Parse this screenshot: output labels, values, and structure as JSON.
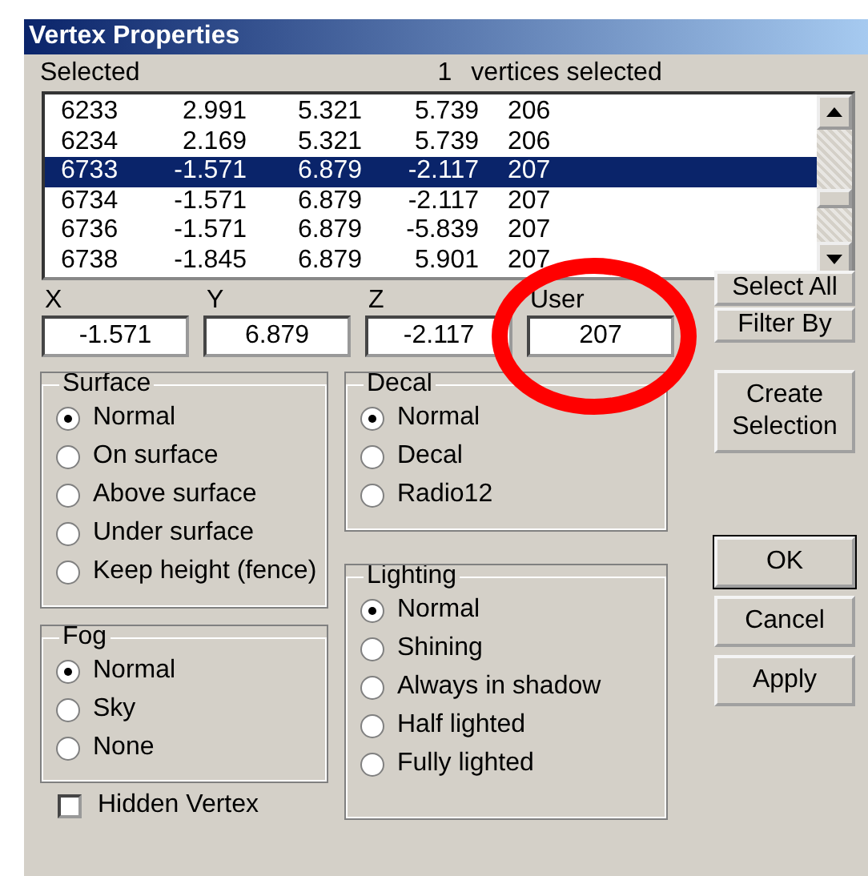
{
  "window": {
    "title": "Vertex Properties"
  },
  "selection": {
    "label": "Selected",
    "count": "1",
    "count_label": "vertices selected"
  },
  "vertex_list": {
    "rows": [
      {
        "cells": [
          "6233",
          "2.991",
          "5.321",
          "5.739",
          "206"
        ],
        "selected": false
      },
      {
        "cells": [
          "6234",
          "2.169",
          "5.321",
          "5.739",
          "206"
        ],
        "selected": false
      },
      {
        "cells": [
          "6733",
          "-1.571",
          "6.879",
          "-2.117",
          "207"
        ],
        "selected": true
      },
      {
        "cells": [
          "6734",
          "-1.571",
          "6.879",
          "-2.117",
          "207"
        ],
        "selected": false
      },
      {
        "cells": [
          "6736",
          "-1.571",
          "6.879",
          "-5.839",
          "207"
        ],
        "selected": false
      },
      {
        "cells": [
          "6738",
          "-1.845",
          "6.879",
          "5.901",
          "207"
        ],
        "selected": false
      }
    ]
  },
  "fields": [
    {
      "label": "X",
      "value": "-1.571"
    },
    {
      "label": "Y",
      "value": "6.879"
    },
    {
      "label": "Z",
      "value": "-2.117"
    },
    {
      "label": "User",
      "value": "207"
    }
  ],
  "surface": {
    "title": "Surface",
    "options": [
      {
        "label": "Normal",
        "selected": true
      },
      {
        "label": "On surface",
        "selected": false
      },
      {
        "label": "Above surface",
        "selected": false
      },
      {
        "label": "Under surface",
        "selected": false
      },
      {
        "label": "Keep height (fence)",
        "selected": false
      }
    ]
  },
  "fog": {
    "title": "Fog",
    "options": [
      {
        "label": "Normal",
        "selected": true
      },
      {
        "label": "Sky",
        "selected": false
      },
      {
        "label": "None",
        "selected": false
      }
    ]
  },
  "hidden_vertex": {
    "label": "Hidden Vertex",
    "checked": false
  },
  "decal": {
    "title": "Decal",
    "options": [
      {
        "label": "Normal",
        "selected": true
      },
      {
        "label": "Decal",
        "selected": false
      },
      {
        "label": "Radio12",
        "selected": false
      }
    ]
  },
  "lighting": {
    "title": "Lighting",
    "options": [
      {
        "label": "Normal",
        "selected": true
      },
      {
        "label": "Shining",
        "selected": false
      },
      {
        "label": "Always in shadow",
        "selected": false
      },
      {
        "label": "Half lighted",
        "selected": false
      },
      {
        "label": "Fully lighted",
        "selected": false
      }
    ]
  },
  "top_buttons": [
    {
      "label": "Select All"
    },
    {
      "label": "Filter By"
    }
  ],
  "create_button": {
    "label": "Create Selection"
  },
  "dialog_buttons": [
    {
      "label": "OK",
      "default": true
    },
    {
      "label": "Cancel",
      "default": false
    },
    {
      "label": "Apply",
      "default": false
    }
  ]
}
